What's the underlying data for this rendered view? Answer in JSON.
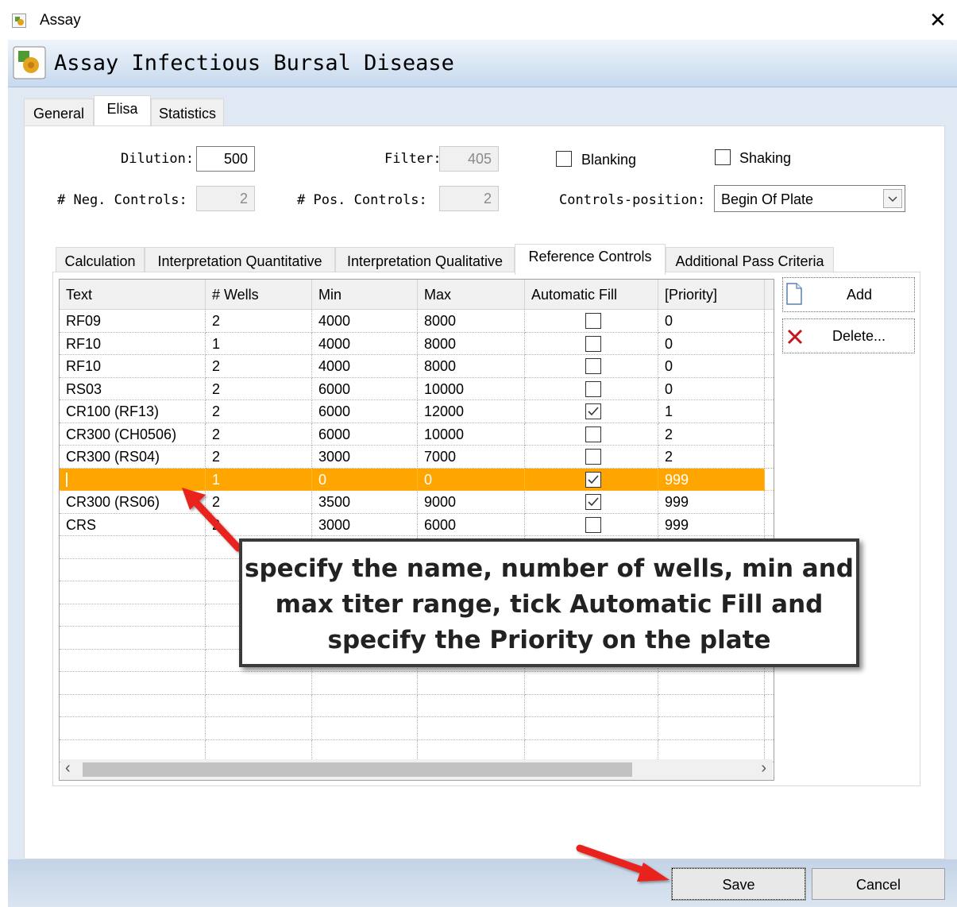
{
  "window": {
    "title": "Assay",
    "close_glyph": "✕"
  },
  "header": {
    "title": "Assay Infectious Bursal Disease",
    "icon": "assay-icon"
  },
  "tabs": [
    {
      "label": "General",
      "active": false
    },
    {
      "label": "Elisa",
      "active": true
    },
    {
      "label": "Statistics",
      "active": false
    }
  ],
  "elisa": {
    "dilution_label": "Dilution:",
    "dilution_value": "500",
    "filter_label": "Filter:",
    "filter_value": "405",
    "blanking_label": "Blanking",
    "blanking_checked": false,
    "shaking_label": "Shaking",
    "shaking_checked": false,
    "neg_controls_label": "# Neg. Controls:",
    "neg_controls_value": "2",
    "pos_controls_label": "# Pos. Controls:",
    "pos_controls_value": "2",
    "controls_position_label": "Controls-position:",
    "controls_position_value": "Begin Of Plate"
  },
  "inner_tabs": [
    {
      "label": "Calculation",
      "active": false
    },
    {
      "label": "Interpretation Quantitative",
      "active": false
    },
    {
      "label": "Interpretation Qualitative",
      "active": false
    },
    {
      "label": "Reference Controls",
      "active": true
    },
    {
      "label": "Additional Pass Criteria",
      "active": false
    }
  ],
  "grid": {
    "columns": [
      "Text",
      "# Wells",
      "Min",
      "Max",
      "Automatic Fill",
      "[Priority]"
    ],
    "rows": [
      {
        "text": "RF09",
        "wells": "2",
        "min": "4000",
        "max": "8000",
        "auto_fill": false,
        "priority": "0",
        "selected": false
      },
      {
        "text": "RF10",
        "wells": "1",
        "min": "4000",
        "max": "8000",
        "auto_fill": false,
        "priority": "0",
        "selected": false
      },
      {
        "text": "RF10",
        "wells": "2",
        "min": "4000",
        "max": "8000",
        "auto_fill": false,
        "priority": "0",
        "selected": false
      },
      {
        "text": "RS03",
        "wells": "2",
        "min": "6000",
        "max": "10000",
        "auto_fill": false,
        "priority": "0",
        "selected": false
      },
      {
        "text": "CR100 (RF13)",
        "wells": "2",
        "min": "6000",
        "max": "12000",
        "auto_fill": true,
        "priority": "1",
        "selected": false
      },
      {
        "text": "CR300 (CH0506)",
        "wells": "2",
        "min": "6000",
        "max": "10000",
        "auto_fill": false,
        "priority": "2",
        "selected": false
      },
      {
        "text": "CR300 (RS04)",
        "wells": "2",
        "min": "3000",
        "max": "7000",
        "auto_fill": false,
        "priority": "2",
        "selected": false
      },
      {
        "text": "",
        "wells": "1",
        "min": "0",
        "max": "0",
        "auto_fill": true,
        "priority": "999",
        "selected": true
      },
      {
        "text": "CR300 (RS06)",
        "wells": "2",
        "min": "3500",
        "max": "9000",
        "auto_fill": true,
        "priority": "999",
        "selected": false
      },
      {
        "text": "CRS",
        "wells": "2",
        "min": "3000",
        "max": "6000",
        "auto_fill": false,
        "priority": "999",
        "selected": false
      }
    ],
    "empty_rows": 10
  },
  "side_buttons": {
    "add_label": "Add",
    "delete_label": "Delete..."
  },
  "dialog_buttons": {
    "save_label": "Save",
    "cancel_label": "Cancel"
  },
  "callout": {
    "lines": [
      "specify the name, number of wells, min and",
      "max titer range, tick Automatic Fill and",
      "specify the Priority on the plate"
    ]
  },
  "colors": {
    "selection": "#ffa500",
    "arrow": "#e8231f",
    "header_gradient_bottom": "#c7d9ee"
  }
}
